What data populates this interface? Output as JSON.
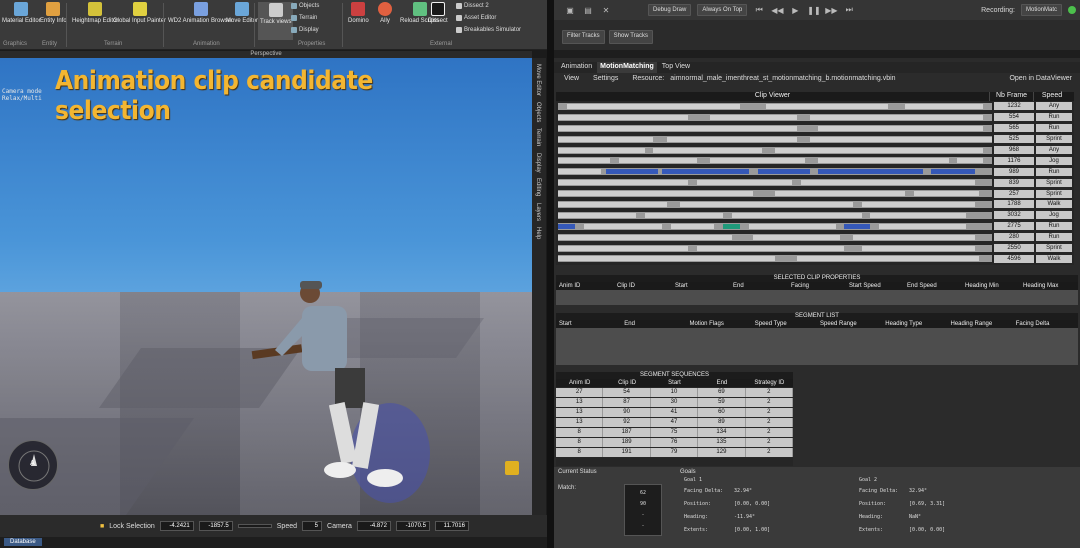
{
  "ribbon": {
    "buttons": [
      {
        "label": "Material\nEditor",
        "color": "#6aa6d8"
      },
      {
        "label": "Entity\nInfo",
        "color": "#e0a040"
      },
      {
        "label": "Heightmap\nEditor",
        "color": "#d4c23a"
      },
      {
        "label": "Global Input\nPainter",
        "color": "#e0d040"
      },
      {
        "label": "WD2 Animation\nBrowser",
        "color": "#7aa0e0"
      },
      {
        "label": "Move\nEditor",
        "color": "#6aa6d8"
      },
      {
        "label": "Track\nviews",
        "color": "#cccccc"
      },
      {
        "label": "Domino",
        "color": "#cc4040"
      },
      {
        "label": "Ally",
        "color": "#e06040"
      },
      {
        "label": "Reload\nScripts",
        "color": "#60c080"
      },
      {
        "label": "Dissect",
        "color": "#f0f0f0"
      }
    ],
    "small_left": [
      "Objects",
      "Terrain",
      "Display"
    ],
    "small_right": [
      "Dissect 2",
      "Asset Editor",
      "Breakables Simulator"
    ],
    "groups": [
      "Graphics",
      "Entity",
      "Terrain",
      "Animation",
      "Properties",
      "External"
    ]
  },
  "viewport": {
    "title": "Perspective",
    "caption": "Animation clip candidate selection",
    "camera_lines": [
      "Camera mode",
      "Relax/Multi"
    ],
    "compass_label": "A",
    "side_tabs": [
      "Move Editor",
      "Objects",
      "Terrain",
      "Display",
      "Editing",
      "Layers",
      "Help",
      "Editor"
    ]
  },
  "statusbar": {
    "lock_label": "Lock Selection",
    "x": "-4.2421",
    "y": "-1857.5",
    "speed_label": "Speed",
    "speed": "5",
    "camera_label": "Camera",
    "cx": "-4.872",
    "cy": "-1070.5",
    "cz": "11.7016"
  },
  "bottom_tab": "Database",
  "right": {
    "toolbar": {
      "debug": "Debug Draw",
      "ontop": "Always On Top",
      "recording": "Recording:",
      "recording_value": "MotionMatc"
    },
    "toolbar2": [
      "Filter Tracks",
      "Show Tracks"
    ],
    "tabs": [
      "Animation",
      "MotionMatching",
      "Top View"
    ],
    "sub": {
      "view": "View",
      "settings": "Settings",
      "resource_label": "Resource:",
      "resource": "aimnormal_male_imenthreat_st_motionmatching_b.motionmatching.vbin",
      "open": "Open in DataViewer"
    },
    "clip_viewer": {
      "title": "Clip Viewer",
      "col_frames": "Nb Frame",
      "col_speed": "Speed",
      "rows": [
        {
          "frames": "1232",
          "speed": "Any"
        },
        {
          "frames": "554",
          "speed": "Run"
        },
        {
          "frames": "565",
          "speed": "Run"
        },
        {
          "frames": "525",
          "speed": "Sprint"
        },
        {
          "frames": "968",
          "speed": "Any"
        },
        {
          "frames": "1176",
          "speed": "Jog"
        },
        {
          "frames": "989",
          "speed": "Run"
        },
        {
          "frames": "839",
          "speed": "Sprint"
        },
        {
          "frames": "257",
          "speed": "Sprint"
        },
        {
          "frames": "1788",
          "speed": "Walk"
        },
        {
          "frames": "3032",
          "speed": "Jog"
        },
        {
          "frames": "2775",
          "speed": "Run"
        },
        {
          "frames": "280",
          "speed": "Run"
        },
        {
          "frames": "2550",
          "speed": "Sprint"
        },
        {
          "frames": "4596",
          "speed": "Walk"
        }
      ]
    },
    "selected_clip": {
      "title": "SELECTED CLIP PROPERTIES",
      "cols": [
        "Anim ID",
        "Clip ID",
        "Start",
        "End",
        "Facing",
        "Start Speed",
        "End Speed",
        "Heading Min",
        "Heading Max"
      ]
    },
    "segment_list": {
      "title": "SEGMENT LIST",
      "cols": [
        "Start",
        "End",
        "Motion Flags",
        "Speed Type",
        "Speed Range",
        "Heading Type",
        "Heading Range",
        "Facing Delta"
      ]
    },
    "sequences": {
      "title": "SEGMENT SEQUENCES",
      "cols": [
        "Anim ID",
        "Clip ID",
        "Start",
        "End",
        "Strategy ID"
      ],
      "rows": [
        [
          "27",
          "54",
          "10",
          "69",
          "2"
        ],
        [
          "13",
          "87",
          "30",
          "59",
          "2"
        ],
        [
          "13",
          "90",
          "41",
          "60",
          "2"
        ],
        [
          "13",
          "92",
          "47",
          "89",
          "2"
        ],
        [
          "8",
          "187",
          "75",
          "134",
          "2"
        ],
        [
          "8",
          "189",
          "76",
          "135",
          "2"
        ],
        [
          "8",
          "191",
          "79",
          "129",
          "2"
        ]
      ]
    },
    "bottom": {
      "current_status": "Current Status",
      "match": "Match:",
      "match_values": [
        "62",
        "90",
        "-",
        "-"
      ],
      "goals": "Goals",
      "goal1": {
        "title": "Goal 1",
        "facing_label": "Facing Delta:",
        "facing": "32.94°",
        "position_label": "Position:",
        "position": "[0.00, 0.00]",
        "heading_label": "Heading:",
        "heading": "-11.94°",
        "extents_label": "Extents:",
        "extents": "[0.00, 1.00]"
      },
      "goal2": {
        "title": "Goal 2",
        "facing_label": "Facing Delta:",
        "facing": "32.94°",
        "position_label": "Position:",
        "position": "[0.69, 3.31]",
        "heading_label": "Heading:",
        "heading": "NaN°",
        "extents_label": "Extents:",
        "extents": "[0.00, 0.00]"
      }
    }
  }
}
